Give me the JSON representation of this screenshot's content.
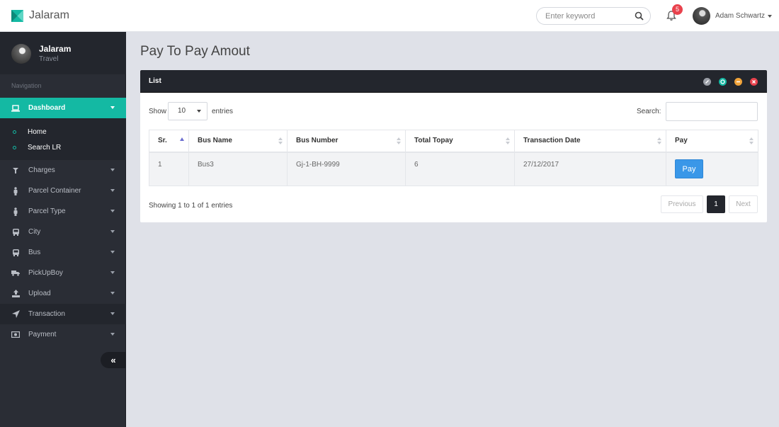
{
  "app": {
    "brand": "Jalaram"
  },
  "topbar": {
    "search_placeholder": "Enter keyword",
    "notification_count": "5",
    "user_name": "Adam Schwartz"
  },
  "sidebar": {
    "profile_name": "Jalaram",
    "profile_sub": "Travel",
    "heading": "Navigation",
    "dashboard": "Dashboard",
    "submenu": [
      "Home",
      "Search LR"
    ],
    "items": [
      "Charges",
      "Parcel Container",
      "Parcel Type",
      "City",
      "Bus",
      "PickUpBoy",
      "Upload",
      "Transaction",
      "Payment"
    ],
    "collapse_glyph": "«"
  },
  "page": {
    "title": "Pay To Pay Amout"
  },
  "panel": {
    "title": "List",
    "show_label": "Show",
    "page_length": "10",
    "entries_label": "entries",
    "search_label": "Search:",
    "columns": [
      "Sr.",
      "Bus Name",
      "Bus Number",
      "Total Topay",
      "Transaction Date",
      "Pay"
    ],
    "rows": [
      {
        "sr": "1",
        "bus_name": "Bus3",
        "bus_number": "Gj-1-BH-9999",
        "total_topay": "6",
        "transaction_date": "27/12/2017",
        "pay_label": "Pay"
      }
    ],
    "info": "Showing 1 to 1 of 1 entries",
    "pagination": {
      "prev": "Previous",
      "current": "1",
      "next": "Next"
    }
  },
  "colors": {
    "accent": "#14b9a3",
    "sidebar": "#2a2d35",
    "pay_button": "#3a97e8",
    "badge": "#e9424d"
  }
}
